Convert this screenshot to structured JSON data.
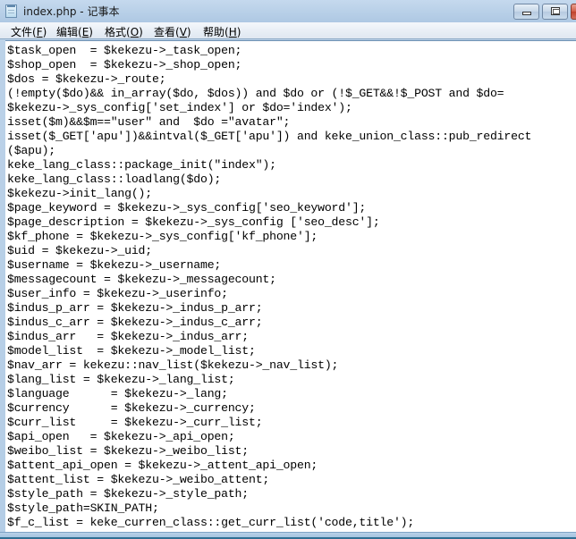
{
  "window": {
    "title": "index.php - 记事本",
    "app_icon": "notepad-icon",
    "caption_buttons": [
      "minimize-icon",
      "maximize-icon",
      "close-icon"
    ]
  },
  "menubar": {
    "items": [
      {
        "label": "文件",
        "accel": "F"
      },
      {
        "label": "编辑",
        "accel": "E"
      },
      {
        "label": "格式",
        "accel": "O"
      },
      {
        "label": "查看",
        "accel": "V"
      },
      {
        "label": "帮助",
        "accel": "H"
      }
    ]
  },
  "editor": {
    "lines": [
      "$task_open  = $kekezu->_task_open;",
      "$shop_open  = $kekezu->_shop_open;",
      "$dos = $kekezu->_route;",
      "(!empty($do)&& in_array($do, $dos)) and $do or (!$_GET&&!$_POST and $do=",
      "$kekezu->_sys_config['set_index'] or $do='index');",
      "isset($m)&&$m==\"user\" and  $do =\"avatar\";",
      "isset($_GET['apu'])&&intval($_GET['apu']) and keke_union_class::pub_redirect",
      "($apu);",
      "keke_lang_class::package_init(\"index\");",
      "keke_lang_class::loadlang($do);",
      "$kekezu->init_lang();",
      "$page_keyword = $kekezu->_sys_config['seo_keyword'];",
      "$page_description = $kekezu->_sys_config ['seo_desc'];",
      "$kf_phone = $kekezu->_sys_config['kf_phone'];",
      "$uid = $kekezu->_uid;",
      "$username = $kekezu->_username;",
      "$messagecount = $kekezu->_messagecount;",
      "$user_info = $kekezu->_userinfo;",
      "$indus_p_arr = $kekezu->_indus_p_arr;",
      "$indus_c_arr = $kekezu->_indus_c_arr;",
      "$indus_arr   = $kekezu->_indus_arr;",
      "$model_list  = $kekezu->_model_list;",
      "$nav_arr = kekezu::nav_list($kekezu->_nav_list);",
      "$lang_list = $kekezu->_lang_list;",
      "$language      = $kekezu->_lang;",
      "$currency      = $kekezu->_currency;",
      "$curr_list     = $kekezu->_curr_list;",
      "$api_open   = $kekezu->_api_open;",
      "$weibo_list = $kekezu->_weibo_list;",
      "$attent_api_open = $kekezu->_attent_api_open;",
      "$attent_list = $kekezu->_weibo_attent;",
      "$style_path = $kekezu->_style_path;",
      "$style_path=SKIN_PATH;",
      "$f_c_list = keke_curren_class::get_curr_list('code,title');"
    ]
  }
}
